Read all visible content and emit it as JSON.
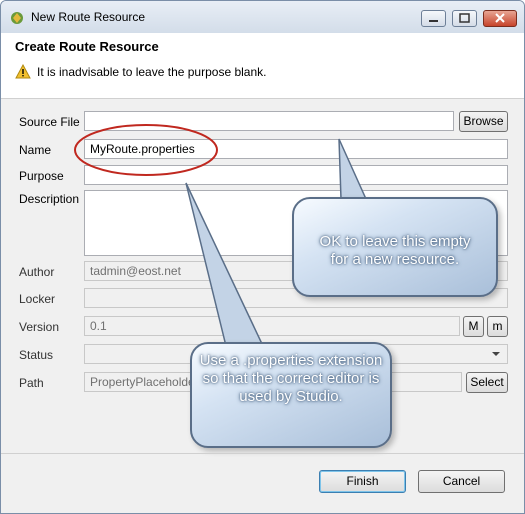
{
  "window": {
    "title": "New Route Resource"
  },
  "header": {
    "title": "Create Route Resource",
    "warning": "It is inadvisable to leave the purpose blank."
  },
  "form": {
    "source_file": {
      "label": "Source File",
      "value": ""
    },
    "browse_label": "Browse",
    "name": {
      "label": "Name",
      "value": "MyRoute.properties"
    },
    "purpose": {
      "label": "Purpose",
      "value": ""
    },
    "description": {
      "label": "Description",
      "value": ""
    },
    "author": {
      "label": "Author",
      "value": "tadmin@eost.net"
    },
    "locker": {
      "label": "Locker",
      "value": ""
    },
    "version": {
      "label": "Version",
      "value": "0.1",
      "major_label": "M",
      "minor_label": "m"
    },
    "status": {
      "label": "Status",
      "value": ""
    },
    "path": {
      "label": "Path",
      "value": "PropertyPlaceholder"
    },
    "select_label": "Select"
  },
  "callouts": {
    "purpose_note": "OK to leave this empty for a new resource.",
    "name_note": "Use a .properties extension so that the correct editor is used by Studio."
  },
  "footer": {
    "finish_label": "Finish",
    "cancel_label": "Cancel"
  },
  "colors": {
    "annotation_circle": "#c0281f",
    "callout_border": "#5a6e88"
  }
}
